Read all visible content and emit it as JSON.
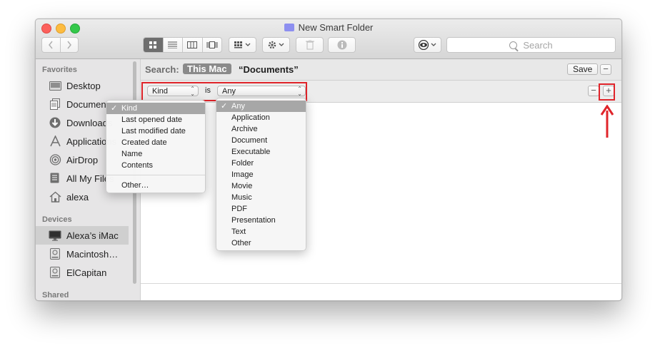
{
  "window": {
    "title": "New Smart Folder"
  },
  "toolbar": {
    "view_buttons": [
      "icon-view-icon",
      "list-view-icon",
      "column-view-icon",
      "cover-flow-icon"
    ],
    "arrange_icon": "arrange-icon",
    "action_icon": "gear-icon",
    "trash_icon": "trash-icon",
    "info_icon": "info-icon",
    "eye_icon": "eye-icon",
    "search_placeholder": "Search"
  },
  "sidebar": {
    "favorites_heading": "Favorites",
    "favorites": [
      {
        "label": "Desktop",
        "icon": "desktop-icon"
      },
      {
        "label": "Documents",
        "icon": "documents-icon"
      },
      {
        "label": "Downloads",
        "icon": "downloads-icon"
      },
      {
        "label": "Applications",
        "icon": "applications-icon"
      },
      {
        "label": "AirDrop",
        "icon": "airdrop-icon"
      },
      {
        "label": "All My Files",
        "icon": "all-files-icon"
      },
      {
        "label": "alexa",
        "icon": "home-icon"
      }
    ],
    "devices_heading": "Devices",
    "devices": [
      {
        "label": "Alexa’s iMac",
        "icon": "imac-icon",
        "selected": true
      },
      {
        "label": "Macintosh…",
        "icon": "disk-icon"
      },
      {
        "label": "ElCapitan",
        "icon": "disk-icon"
      }
    ],
    "shared_heading": "Shared"
  },
  "searchbar": {
    "label": "Search:",
    "scope_selected": "This Mac",
    "scope_other": "“Documents”",
    "save_label": "Save",
    "remove_label": "−"
  },
  "criteria": {
    "attribute": "Kind",
    "operator": "is",
    "value": "Any",
    "remove_label": "−",
    "add_label": "+"
  },
  "attribute_menu": {
    "items": [
      "Kind",
      "Last opened date",
      "Last modified date",
      "Created date",
      "Name",
      "Contents"
    ],
    "checked": "Kind",
    "other": "Other…"
  },
  "kind_menu": {
    "items": [
      "Any",
      "Application",
      "Archive",
      "Document",
      "Executable",
      "Folder",
      "Image",
      "Movie",
      "Music",
      "PDF",
      "Presentation",
      "Text",
      "Other"
    ],
    "checked": "Any"
  },
  "annotation": {
    "color": "#e0242a"
  }
}
